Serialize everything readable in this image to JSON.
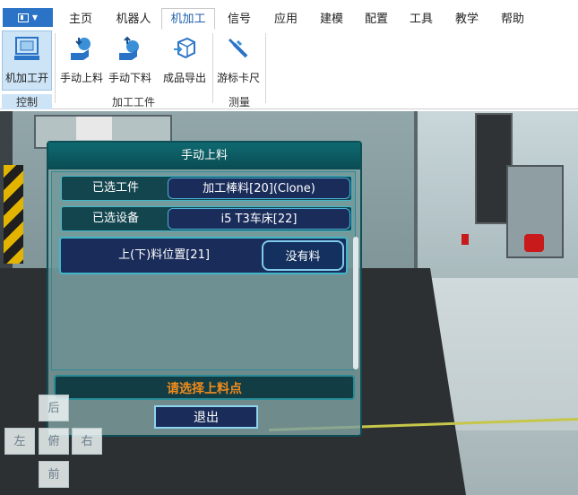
{
  "ribbon": {
    "tabs": [
      "主页",
      "机器人",
      "机加工",
      "信号",
      "应用",
      "建模",
      "配置",
      "工具",
      "教学",
      "帮助"
    ],
    "active_tab": "机加工",
    "groups": [
      {
        "label": "控制",
        "buttons": [
          {
            "label": "机加工开",
            "icon": "machining-on-icon"
          }
        ]
      },
      {
        "label": "加工工件",
        "buttons": [
          {
            "label": "手动上料",
            "icon": "manual-load-icon"
          },
          {
            "label": "手动下料",
            "icon": "manual-unload-icon"
          },
          {
            "label": "成品导出",
            "icon": "product-export-icon"
          }
        ]
      },
      {
        "label": "测量",
        "buttons": [
          {
            "label": "游标卡尺",
            "icon": "vernier-caliper-icon"
          }
        ]
      }
    ]
  },
  "dialog": {
    "title": "手动上料",
    "selected_workpiece_label": "已选工件",
    "selected_workpiece_value": "加工棒料[20](Clone)",
    "selected_device_label": "已选设备",
    "selected_device_value": "i5 T3车床[22]",
    "position_label": "上(下)料位置[21]",
    "position_status": "没有料",
    "hint": "请选择上料点",
    "exit_label": "退出"
  },
  "nav_cube": {
    "back": "后",
    "left": "左",
    "top": "俯",
    "right": "右",
    "front": "前"
  },
  "colors": {
    "accent": "#2a73c6",
    "dialog_header": "#0f6970",
    "hint": "#f08b1c"
  }
}
